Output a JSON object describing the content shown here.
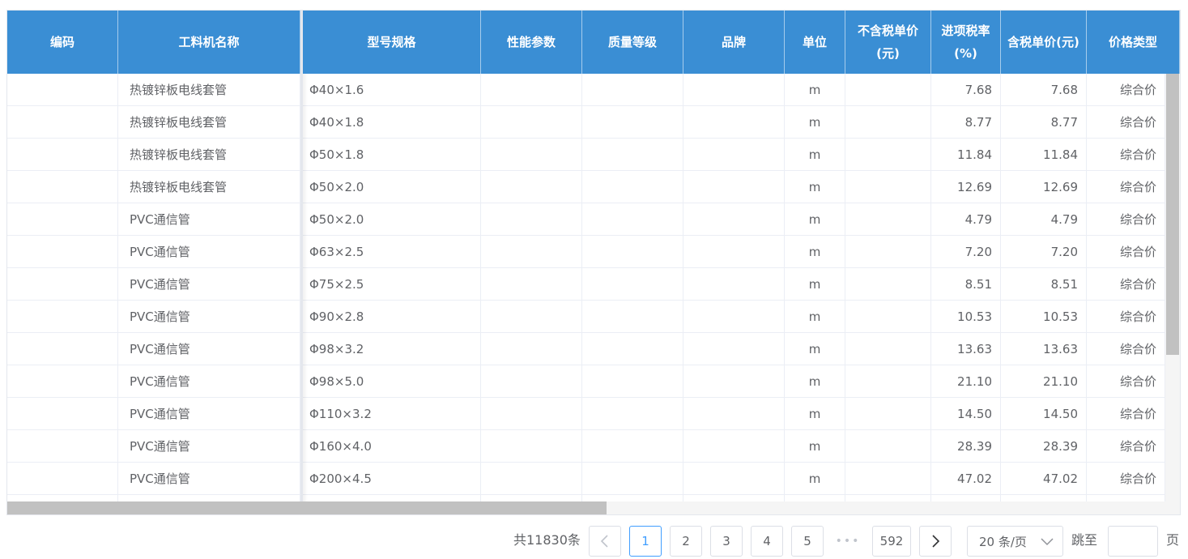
{
  "table": {
    "columns": [
      {
        "key": "code",
        "label": "编码"
      },
      {
        "key": "name",
        "label": "工料机名称"
      },
      {
        "key": "spec",
        "label": "型号规格"
      },
      {
        "key": "perf",
        "label": "性能参数"
      },
      {
        "key": "quality",
        "label": "质量等级"
      },
      {
        "key": "brand",
        "label": "品牌"
      },
      {
        "key": "unit",
        "label": "单位"
      },
      {
        "key": "price_ex",
        "label": "不含税单价(元)"
      },
      {
        "key": "tax",
        "label": "进项税率(%)"
      },
      {
        "key": "price_in",
        "label": "含税单价(元)"
      },
      {
        "key": "ptype",
        "label": "价格类型"
      }
    ],
    "rows": [
      {
        "code": "",
        "name": "热镀锌板电线套管",
        "spec": "Φ40×1.6",
        "perf": "",
        "quality": "",
        "brand": "",
        "unit": "m",
        "price_ex": "",
        "tax": "7.68",
        "price_in": "7.68",
        "ptype": "综合价"
      },
      {
        "code": "",
        "name": "热镀锌板电线套管",
        "spec": "Φ40×1.8",
        "perf": "",
        "quality": "",
        "brand": "",
        "unit": "m",
        "price_ex": "",
        "tax": "8.77",
        "price_in": "8.77",
        "ptype": "综合价"
      },
      {
        "code": "",
        "name": "热镀锌板电线套管",
        "spec": "Φ50×1.8",
        "perf": "",
        "quality": "",
        "brand": "",
        "unit": "m",
        "price_ex": "",
        "tax": "11.84",
        "price_in": "11.84",
        "ptype": "综合价"
      },
      {
        "code": "",
        "name": "热镀锌板电线套管",
        "spec": "Φ50×2.0",
        "perf": "",
        "quality": "",
        "brand": "",
        "unit": "m",
        "price_ex": "",
        "tax": "12.69",
        "price_in": "12.69",
        "ptype": "综合价"
      },
      {
        "code": "",
        "name": "PVC通信管",
        "spec": "Φ50×2.0",
        "perf": "",
        "quality": "",
        "brand": "",
        "unit": "m",
        "price_ex": "",
        "tax": "4.79",
        "price_in": "4.79",
        "ptype": "综合价"
      },
      {
        "code": "",
        "name": "PVC通信管",
        "spec": "Φ63×2.5",
        "perf": "",
        "quality": "",
        "brand": "",
        "unit": "m",
        "price_ex": "",
        "tax": "7.20",
        "price_in": "7.20",
        "ptype": "综合价"
      },
      {
        "code": "",
        "name": "PVC通信管",
        "spec": "Φ75×2.5",
        "perf": "",
        "quality": "",
        "brand": "",
        "unit": "m",
        "price_ex": "",
        "tax": "8.51",
        "price_in": "8.51",
        "ptype": "综合价"
      },
      {
        "code": "",
        "name": "PVC通信管",
        "spec": "Φ90×2.8",
        "perf": "",
        "quality": "",
        "brand": "",
        "unit": "m",
        "price_ex": "",
        "tax": "10.53",
        "price_in": "10.53",
        "ptype": "综合价"
      },
      {
        "code": "",
        "name": "PVC通信管",
        "spec": "Φ98×3.2",
        "perf": "",
        "quality": "",
        "brand": "",
        "unit": "m",
        "price_ex": "",
        "tax": "13.63",
        "price_in": "13.63",
        "ptype": "综合价"
      },
      {
        "code": "",
        "name": "PVC通信管",
        "spec": "Φ98×5.0",
        "perf": "",
        "quality": "",
        "brand": "",
        "unit": "m",
        "price_ex": "",
        "tax": "21.10",
        "price_in": "21.10",
        "ptype": "综合价"
      },
      {
        "code": "",
        "name": "PVC通信管",
        "spec": "Φ110×3.2",
        "perf": "",
        "quality": "",
        "brand": "",
        "unit": "m",
        "price_ex": "",
        "tax": "14.50",
        "price_in": "14.50",
        "ptype": "综合价"
      },
      {
        "code": "",
        "name": "PVC通信管",
        "spec": "Φ160×4.0",
        "perf": "",
        "quality": "",
        "brand": "",
        "unit": "m",
        "price_ex": "",
        "tax": "28.39",
        "price_in": "28.39",
        "ptype": "综合价"
      },
      {
        "code": "",
        "name": "PVC通信管",
        "spec": "Φ200×4.5",
        "perf": "",
        "quality": "",
        "brand": "",
        "unit": "m",
        "price_ex": "",
        "tax": "47.02",
        "price_in": "47.02",
        "ptype": "综合价"
      },
      {
        "code": "",
        "name": "",
        "spec": "",
        "perf": "",
        "quality": "",
        "brand": "",
        "unit": "",
        "price_ex": "",
        "tax": "",
        "price_in": "",
        "ptype": ""
      }
    ]
  },
  "pagination": {
    "total_text": "共11830条",
    "prev_icon": "chevron-left-icon",
    "next_icon": "chevron-right-icon",
    "pages": [
      "1",
      "2",
      "3",
      "4",
      "5"
    ],
    "active_page": "1",
    "ellipsis": "•••",
    "last_page": "592",
    "page_size": "20 条/页",
    "page_size_icon": "chevron-down-icon",
    "jump_label": "跳至",
    "jump_value": "",
    "jump_suffix": "页"
  },
  "colors": {
    "header_bg": "#3a8ed4",
    "active_page": "#409eff"
  }
}
